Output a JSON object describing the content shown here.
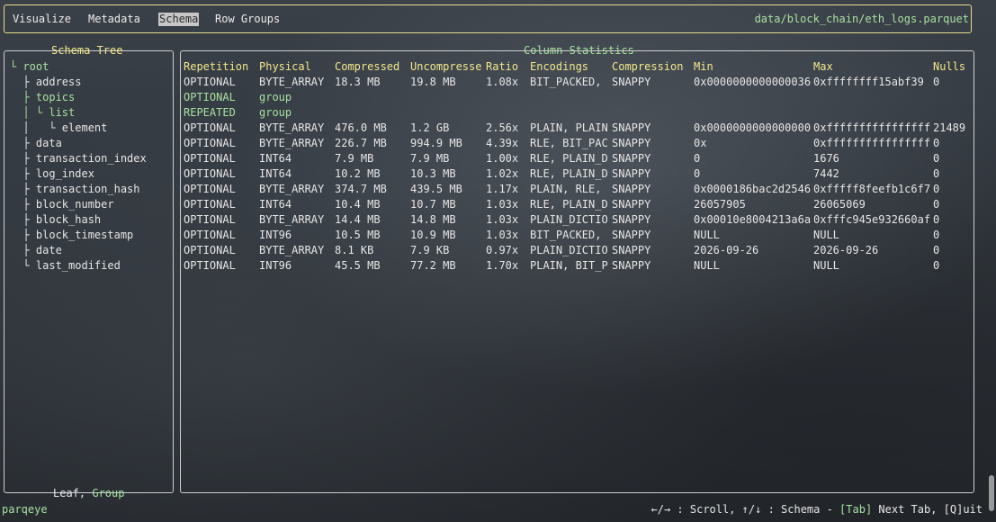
{
  "tabs": [
    {
      "label": "Visualize",
      "active": false
    },
    {
      "label": "Metadata",
      "active": false
    },
    {
      "label": "Schema",
      "active": true
    },
    {
      "label": "Row Groups",
      "active": false
    }
  ],
  "file_path": "data/block_chain/eth_logs.parquet",
  "schema_tree": {
    "title": "Schema Tree",
    "rows": [
      {
        "prefix": "└ ",
        "name": "root",
        "kind": "group"
      },
      {
        "prefix": "  ├ ",
        "name": "address",
        "kind": "leaf"
      },
      {
        "prefix": "  ├ ",
        "name": "topics",
        "kind": "group"
      },
      {
        "prefix": "  │ └ ",
        "name": "list",
        "kind": "group"
      },
      {
        "prefix": "  │   └ ",
        "name": "element",
        "kind": "leaf"
      },
      {
        "prefix": "  ├ ",
        "name": "data",
        "kind": "leaf"
      },
      {
        "prefix": "  ├ ",
        "name": "transaction_index",
        "kind": "leaf"
      },
      {
        "prefix": "  ├ ",
        "name": "log_index",
        "kind": "leaf"
      },
      {
        "prefix": "  ├ ",
        "name": "transaction_hash",
        "kind": "leaf"
      },
      {
        "prefix": "  ├ ",
        "name": "block_number",
        "kind": "leaf"
      },
      {
        "prefix": "  ├ ",
        "name": "block_hash",
        "kind": "leaf"
      },
      {
        "prefix": "  ├ ",
        "name": "block_timestamp",
        "kind": "leaf"
      },
      {
        "prefix": "  ├ ",
        "name": "date",
        "kind": "leaf"
      },
      {
        "prefix": "  └ ",
        "name": "last_modified",
        "kind": "leaf"
      }
    ],
    "legend_leaf": "Leaf",
    "legend_sep": ", ",
    "legend_group": "Group"
  },
  "column_stats": {
    "title": "Column Statistics",
    "headers": [
      "Repetition",
      "Physical",
      "Compressed",
      "Uncompresse",
      "Ratio",
      "Encodings",
      "Compression",
      "Min",
      "Max",
      "Nulls"
    ],
    "rows": [
      [
        "OPTIONAL",
        "BYTE_ARRAY",
        "18.3 MB",
        "19.8 MB",
        "1.08x",
        "BIT_PACKED,",
        "SNAPPY",
        "0x0000000000000036",
        "0xffffffff15abf39",
        "0"
      ],
      [
        "OPTIONAL",
        "group",
        "",
        "",
        "",
        "",
        "",
        "",
        "",
        ""
      ],
      [
        "REPEATED",
        "group",
        "",
        "",
        "",
        "",
        "",
        "",
        "",
        ""
      ],
      [
        "OPTIONAL",
        "BYTE_ARRAY",
        "476.0 MB",
        "1.2 GB",
        "2.56x",
        "PLAIN, PLAIN",
        "SNAPPY",
        "0x0000000000000000",
        "0xffffffffffffffff",
        "21489"
      ],
      [
        "OPTIONAL",
        "BYTE_ARRAY",
        "226.7 MB",
        "994.9 MB",
        "4.39x",
        "RLE, BIT_PAC",
        "SNAPPY",
        "0x",
        "0xffffffffffffffff",
        "0"
      ],
      [
        "OPTIONAL",
        "INT64",
        "7.9 MB",
        "7.9 MB",
        "1.00x",
        "RLE, PLAIN_D",
        "SNAPPY",
        "0",
        "1676",
        "0"
      ],
      [
        "OPTIONAL",
        "INT64",
        "10.2 MB",
        "10.3 MB",
        "1.02x",
        "RLE, PLAIN_D",
        "SNAPPY",
        "0",
        "7442",
        "0"
      ],
      [
        "OPTIONAL",
        "BYTE_ARRAY",
        "374.7 MB",
        "439.5 MB",
        "1.17x",
        "PLAIN, RLE,",
        "SNAPPY",
        "0x0000186bac2d2546",
        "0xfffff8feefb1c6f7",
        "0"
      ],
      [
        "OPTIONAL",
        "INT64",
        "10.4 MB",
        "10.7 MB",
        "1.03x",
        "RLE, PLAIN_D",
        "SNAPPY",
        "26057905",
        "26065069",
        "0"
      ],
      [
        "OPTIONAL",
        "BYTE_ARRAY",
        "14.4 MB",
        "14.8 MB",
        "1.03x",
        "PLAIN_DICTIO",
        "SNAPPY",
        "0x00010e8004213a6a",
        "0xfffc945e932660af",
        "0"
      ],
      [
        "OPTIONAL",
        "INT96",
        "10.5 MB",
        "10.9 MB",
        "1.03x",
        "BIT_PACKED,",
        "SNAPPY",
        "NULL",
        "NULL",
        "0"
      ],
      [
        "OPTIONAL",
        "BYTE_ARRAY",
        "8.1 KB",
        "7.9 KB",
        "0.97x",
        "PLAIN_DICTIO",
        "SNAPPY",
        "2026-09-26",
        "2026-09-26",
        "0"
      ],
      [
        "OPTIONAL",
        "INT96",
        "45.5 MB",
        "77.2 MB",
        "1.70x",
        "PLAIN, BIT_P",
        "SNAPPY",
        "NULL",
        "NULL",
        "0"
      ]
    ],
    "group_row_indices": [
      1,
      2
    ]
  },
  "status_bar": {
    "app_name": "parqeye",
    "help_a": "←/→ : Scroll, ↑/↓ : Schema - ",
    "help_tab": "[Tab]",
    "help_b": " Next Tab, [Q]uit"
  },
  "colors": {
    "accent_yellow": "#f2e88c",
    "group_green": "#a7e0a0",
    "text": "#e6e6e6"
  }
}
